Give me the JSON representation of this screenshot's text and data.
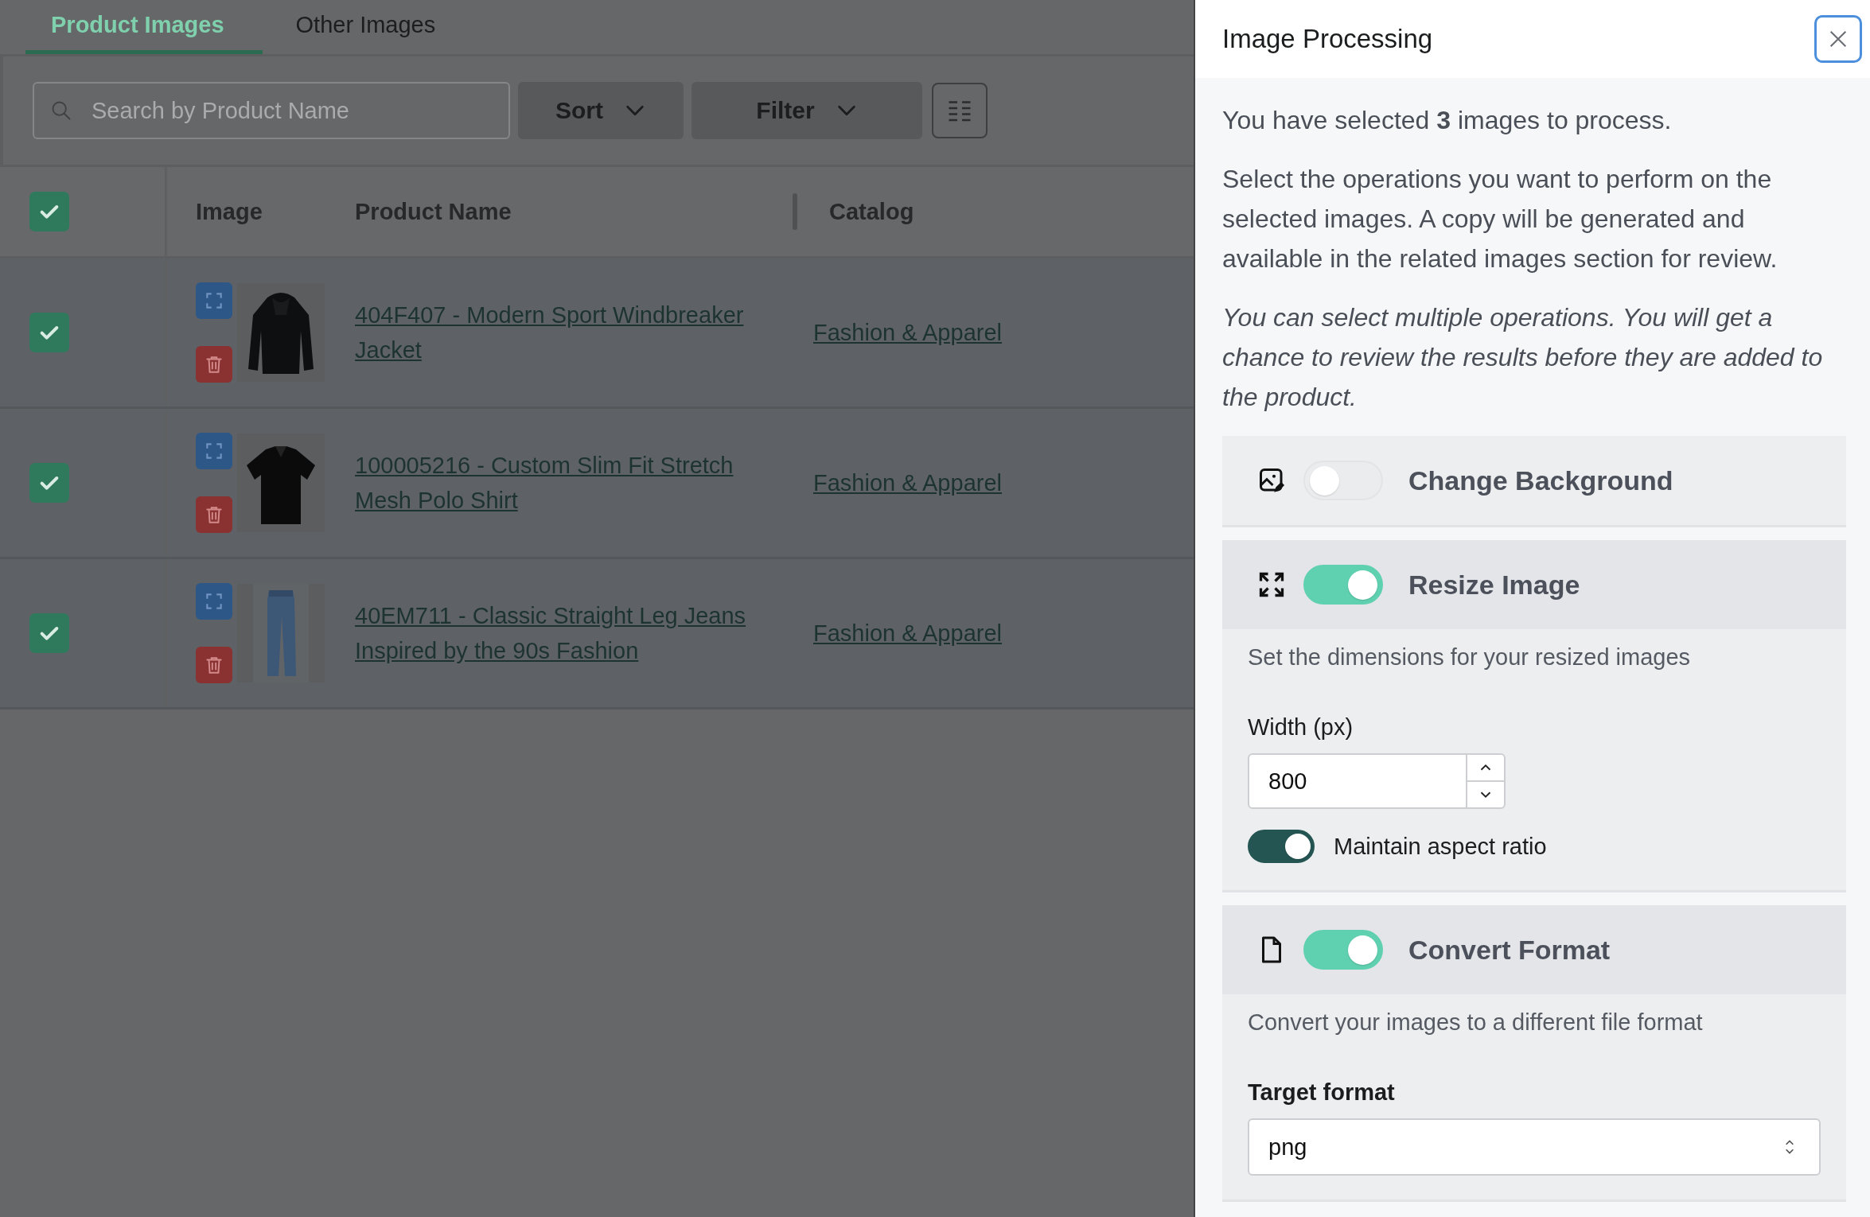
{
  "tabs": [
    {
      "label": "Product Images",
      "selected": true
    },
    {
      "label": "Other Images",
      "selected": false
    }
  ],
  "toolbar": {
    "search": {
      "placeholder": "Search by Product Name"
    },
    "sort_button": "Sort",
    "filter_button": "Filter"
  },
  "table": {
    "select_all_checked": true,
    "columns": [
      "Image",
      "Product Name",
      "Catalog"
    ],
    "rows": [
      {
        "checked": true,
        "product_name": "404F407 - Modern Sport Windbreaker Jacket",
        "catalog": "Fashion & Apparel"
      },
      {
        "checked": true,
        "product_name": "100005216 - Custom Slim Fit Stretch Mesh Polo Shirt",
        "catalog": "Fashion & Apparel"
      },
      {
        "checked": true,
        "product_name": "40EM711 - Classic Straight Leg Jeans Inspired by the 90s Fashion",
        "catalog": "Fashion & Apparel"
      }
    ]
  },
  "panel": {
    "title": "Image Processing",
    "intro": "You have selected **3** images to process.",
    "description": "Select the operations you want to perform on the selected images. A copy will be generated and available in the related images section for review.",
    "note": "You can select multiple operations. You will get a chance to review the results before they are added to the product.",
    "operations": [
      {
        "kind": "background",
        "title": "Change Background",
        "on": false
      },
      {
        "kind": "resize",
        "title": "Resize Image",
        "on": true,
        "description": "Set the dimensions for your resized images",
        "width_label": "Width (px)",
        "width_value": "800",
        "aspect_label": "Maintain aspect ratio",
        "aspect_on": true
      },
      {
        "kind": "convert",
        "title": "Convert Format",
        "on": true,
        "description": "Convert your images to a different file format",
        "format_label": "Target format",
        "format_value": "png"
      }
    ]
  }
}
